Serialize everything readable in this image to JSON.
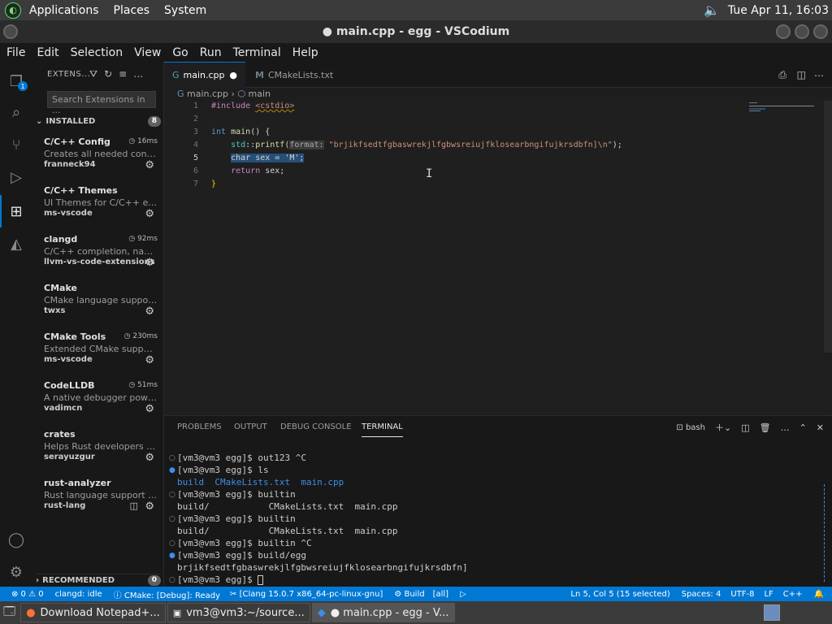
{
  "top_panel": {
    "menus": [
      "Applications",
      "Places",
      "System"
    ],
    "datetime": "Tue Apr 11, 16:03"
  },
  "window": {
    "title": "● main.cpp - egg - VSCodium"
  },
  "menubar": [
    "File",
    "Edit",
    "Selection",
    "View",
    "Go",
    "Run",
    "Terminal",
    "Help"
  ],
  "activity": {
    "explorer_badge": "1"
  },
  "sidebar": {
    "header": "EXTENS...",
    "search_placeholder": "Search Extensions in ...",
    "installed_label": "INSTALLED",
    "installed_count": "8",
    "recommended_label": "RECOMMENDED",
    "recommended_count": "0",
    "extensions": [
      {
        "name": "C/C++ Config",
        "time": "16ms",
        "desc": "Creates all needed config ...",
        "publisher": "franneck94"
      },
      {
        "name": "C/C++ Themes",
        "time": "",
        "desc": "UI Themes for C/C++ exte...",
        "publisher": "ms-vscode"
      },
      {
        "name": "clangd",
        "time": "92ms",
        "desc": "C/C++ completion, navigat...",
        "publisher": "llvm-vs-code-extensions"
      },
      {
        "name": "CMake",
        "time": "",
        "desc": "CMake language support f...",
        "publisher": "twxs"
      },
      {
        "name": "CMake Tools",
        "time": "230ms",
        "desc": "Extended CMake support i...",
        "publisher": "ms-vscode"
      },
      {
        "name": "CodeLLDB",
        "time": "51ms",
        "desc": "A native debugger powere...",
        "publisher": "vadimcn"
      },
      {
        "name": "crates",
        "time": "",
        "desc": "Helps Rust developers ma...",
        "publisher": "serayuzgur"
      },
      {
        "name": "rust-analyzer",
        "time": "",
        "desc": "Rust language support for...",
        "publisher": "rust-lang"
      }
    ]
  },
  "tabs": [
    {
      "label": "main.cpp",
      "modified": "●"
    },
    {
      "label": "CMakeLists.txt"
    }
  ],
  "breadcrumb": {
    "file": "main.cpp",
    "symbol": "main"
  },
  "code": {
    "line_numbers": [
      "1",
      "2",
      "3",
      "4",
      "5",
      "6",
      "7"
    ],
    "l1_inc": "#include",
    "l1_hdr": "<cstdio>",
    "l3_type": "int",
    "l3_fn": "main",
    "l3_rest": "() {",
    "l4_ns": "std",
    "l4_fn": "printf",
    "l4_hint": "format:",
    "l4_str": "\"brjikfsedtfgbaswrekjlfgbwsreiujfklosearbngifujkrsdbfn]\\n\"",
    "l4_end": ");",
    "l5": "char sex = 'M';",
    "l6_kw": "return",
    "l6_rest": " sex;",
    "l7": "}"
  },
  "panel": {
    "tabs": [
      "PROBLEMS",
      "OUTPUT",
      "DEBUG CONSOLE",
      "TERMINAL"
    ],
    "terminal_name": "bash",
    "terminal_lines": [
      "[vm3@vm3 egg]$ out123 ^C",
      "[vm3@vm3 egg]$ ls",
      "build  CMakeLists.txt  main.cpp",
      "[vm3@vm3 egg]$ builtin",
      "build/           CMakeLists.txt  main.cpp",
      "[vm3@vm3 egg]$ builtin",
      "build/           CMakeLists.txt  main.cpp",
      "[vm3@vm3 egg]$ builtin ^C",
      "[vm3@vm3 egg]$ build/egg",
      "brjikfsedtfgbaswrekjlfgbwsreiujfklosearbngifujkrsdbfn]",
      "[vm3@vm3 egg]$ "
    ]
  },
  "status": {
    "problems": "⊗ 0 ⚠ 0",
    "clangd": "clangd: idle",
    "cmake": "CMake: [Debug]: Ready",
    "kit": "[Clang 15.0.7 x86_64-pc-linux-gnu]",
    "build": "Build",
    "target": "[all]",
    "position": "Ln 5, Col 5 (15 selected)",
    "spaces": "Spaces: 4",
    "encoding": "UTF-8",
    "eol": "LF",
    "lang": "C++"
  },
  "taskbar": {
    "items": [
      "Download Notepad+...",
      "vm3@vm3:~/source...",
      "● main.cpp - egg - V..."
    ]
  }
}
